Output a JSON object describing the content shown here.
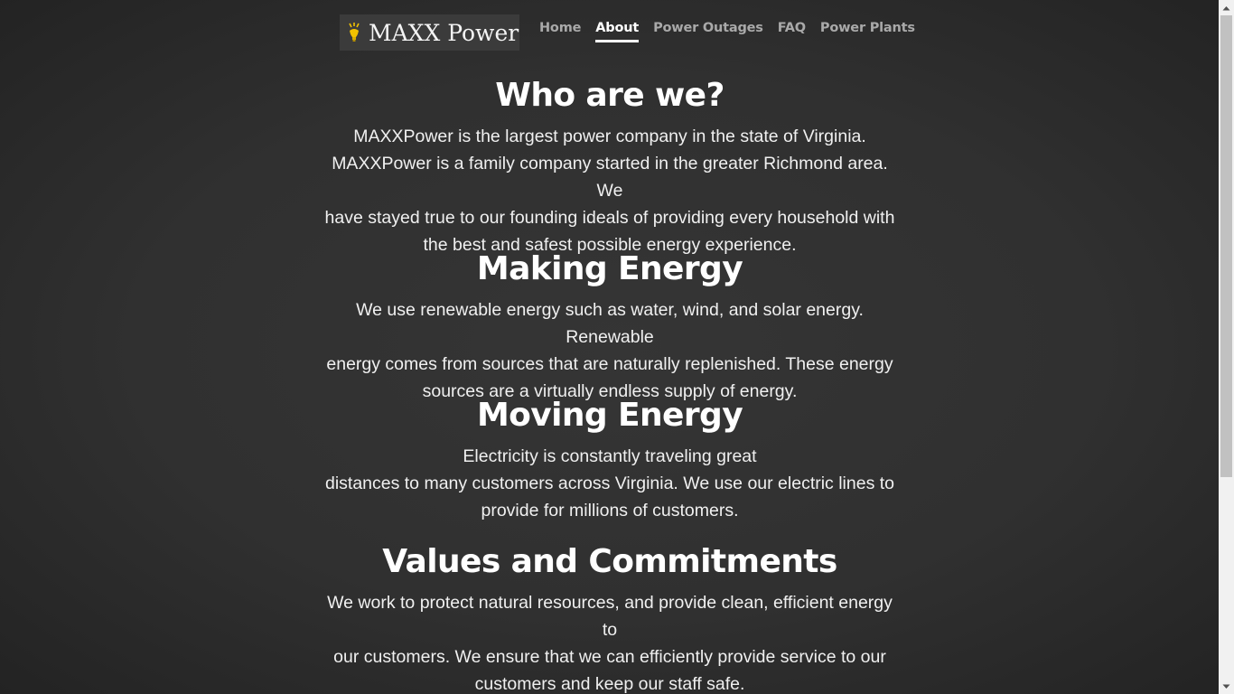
{
  "header": {
    "logo_text": "MAXX Power",
    "nav": [
      {
        "label": "Home",
        "active": false
      },
      {
        "label": "About",
        "active": true
      },
      {
        "label": "Power Outages",
        "active": false
      },
      {
        "label": "FAQ",
        "active": false
      },
      {
        "label": "Power Plants",
        "active": false
      }
    ]
  },
  "sections": [
    {
      "heading": "Who are we?",
      "lines": [
        "MAXXPower is the largest power company in the state of Virginia.",
        "MAXXPower is a family company started in the greater Richmond area. We",
        "have stayed true to our founding ideals of providing every household with",
        "the best and safest possible energy experience."
      ]
    },
    {
      "heading": "Making Energy",
      "lines": [
        "We use renewable energy such as water, wind, and solar energy. Renewable",
        "energy comes from sources that are naturally replenished. These energy",
        "sources are a virtually endless supply of energy."
      ]
    },
    {
      "heading": "Moving Energy",
      "lines": [
        "Electricity is constantly traveling great",
        "distances to many customers across Virginia. We use our electric lines to",
        "provide for millions of customers."
      ]
    },
    {
      "heading": "Values and Commitments",
      "lines": [
        "We work to protect natural resources, and provide clean, efficient energy to",
        "our customers. We ensure that we can efficiently provide service to our",
        "customers and keep our staff safe."
      ]
    }
  ],
  "icons": {
    "logo_icon": "lightbulb-icon"
  },
  "colors": {
    "background": "#333333",
    "text": "#f2f2f2",
    "nav_inactive": "#a9a9a9",
    "nav_active": "#ffffff",
    "logo_accent": "#f2c200"
  }
}
